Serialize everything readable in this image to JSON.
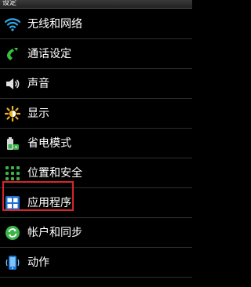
{
  "header": {
    "title": "设定"
  },
  "items": [
    {
      "label": "无线和网络",
      "icon": "wifi-icon"
    },
    {
      "label": "通话设定",
      "icon": "phone-icon"
    },
    {
      "label": "声音",
      "icon": "speaker-icon"
    },
    {
      "label": "显示",
      "icon": "brightness-icon"
    },
    {
      "label": "省电模式",
      "icon": "battery-icon"
    },
    {
      "label": "位置和安全",
      "icon": "location-security-icon"
    },
    {
      "label": "应用程序",
      "icon": "apps-grid-icon"
    },
    {
      "label": "帐户和同步",
      "icon": "sync-icon"
    },
    {
      "label": "动作",
      "icon": "motion-phone-icon"
    }
  ],
  "colors": {
    "background": "#000000",
    "text": "#ffffff",
    "highlight": "#d6262a",
    "divider": "#2e2e2e"
  }
}
